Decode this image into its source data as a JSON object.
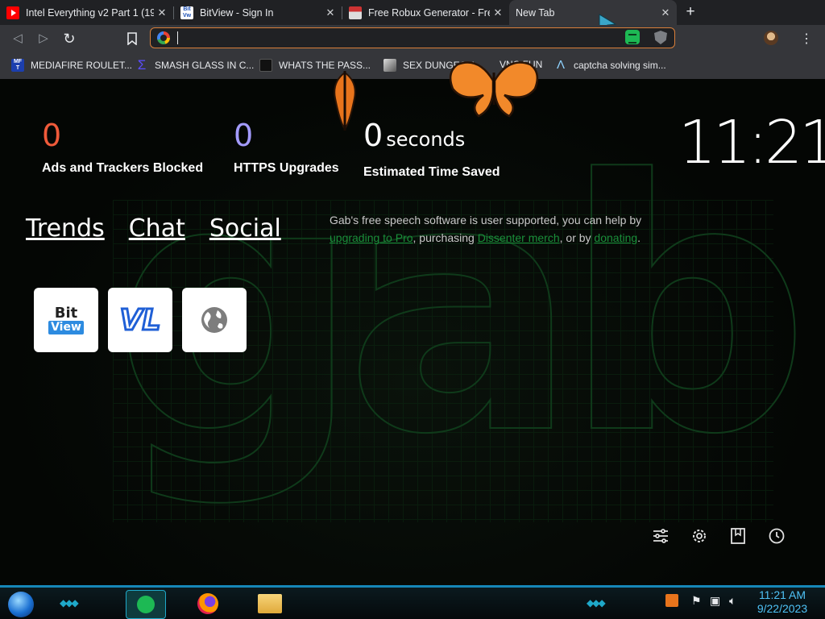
{
  "tabs": [
    {
      "title": "Intel Everything v2 Part 1 (19",
      "favicon": "youtube-icon"
    },
    {
      "title": "BitView - Sign In",
      "favicon": "bitview-icon"
    },
    {
      "title": "Free Robux Generator - Free",
      "favicon": "generic-page-icon"
    },
    {
      "title": "New Tab",
      "favicon": "none",
      "active": true
    }
  ],
  "newtab_symbol": "+",
  "close_symbol": "✕",
  "toolbar": {
    "back": "◁",
    "forward": "▷",
    "reload": "↻",
    "bookmark": "⌧",
    "menu": "⋮"
  },
  "omnibox": {
    "value": "",
    "placeholder": ""
  },
  "bookmarks": [
    {
      "label": "MEDIAFIRE ROULET...",
      "icon": "mft-icon",
      "color": "#1c3fae"
    },
    {
      "label": "SMASH GLASS IN C...",
      "icon": "sigma-icon",
      "color": "#3b2fc9"
    },
    {
      "label": "WHATS THE PASS...",
      "icon": "lock-icon",
      "color": "#111111"
    },
    {
      "label": "SEX DUNGEON",
      "icon": "cube-icon",
      "color": "#444444"
    },
    {
      "label": "VNC FUN",
      "icon": "vnc-icon",
      "color": "#888888"
    },
    {
      "label": "captcha solving sim...",
      "icon": "triangle-icon",
      "color": "#35363a"
    }
  ],
  "stats": [
    {
      "value": "0",
      "unit": "",
      "label": "Ads and Trackers Blocked",
      "color": "#f05a3a"
    },
    {
      "value": "0",
      "unit": "",
      "label": "HTTPS Upgrades",
      "color": "#a39bff"
    },
    {
      "value": "0",
      "unit": "seconds",
      "label": "Estimated Time Saved",
      "color": "#ffffff"
    }
  ],
  "clock": "11:21",
  "nav_links": [
    "Trends",
    "Chat",
    "Social"
  ],
  "promo": {
    "before": "Gab's free speech software is user supported, you can help by ",
    "link1": "upgrading to Pro",
    "middle": ", purchasing ",
    "link2": "Dissenter merch",
    "after1": ", or by ",
    "link3": "donating",
    "end": "."
  },
  "tiles": [
    {
      "name": "bitview-tile",
      "text1": "Bit",
      "text2": "View"
    },
    {
      "name": "vl-tile",
      "text1": "VL"
    },
    {
      "name": "globe-tile"
    }
  ],
  "background_word": "gab",
  "bottom_icons": [
    "customize-icon",
    "settings-icon",
    "bookmarks-icon",
    "history-icon"
  ],
  "taskbar": {
    "time": "11:21 AM",
    "date": "9/22/2023",
    "accent": "#1687b8"
  }
}
